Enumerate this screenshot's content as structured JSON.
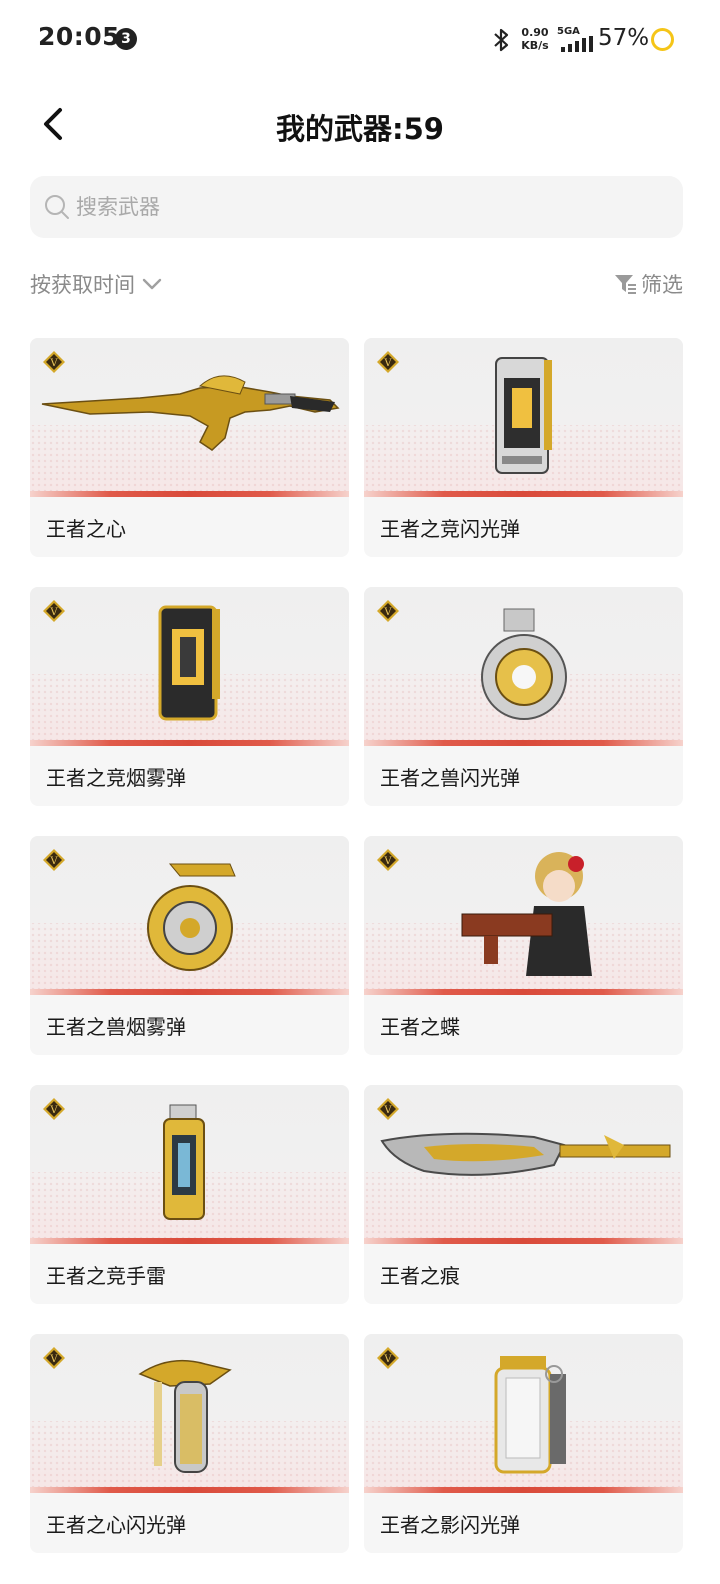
{
  "status_bar": {
    "time": "20:05",
    "notification_count": "3",
    "net_speed_value": "0.90",
    "net_speed_unit": "KB/s",
    "network_type": "5GA",
    "battery": "57%"
  },
  "header": {
    "title": "我的武器:59"
  },
  "search": {
    "placeholder": "搜索武器"
  },
  "toolbar": {
    "sort_label": "按获取时间",
    "filter_label": "筛选"
  },
  "colors": {
    "accent_red": "#d94a3a",
    "gold": "#d4a82a",
    "battery_ring": "#f5c518"
  },
  "weapons": [
    {
      "name": "王者之心",
      "icon": "rifle-icon"
    },
    {
      "name": "王者之竞闪光弹",
      "icon": "flashbang-icon"
    },
    {
      "name": "王者之竞烟雾弹",
      "icon": "smoke-grenade-icon"
    },
    {
      "name": "王者之兽闪光弹",
      "icon": "flashbang-icon"
    },
    {
      "name": "王者之兽烟雾弹",
      "icon": "smoke-grenade-icon"
    },
    {
      "name": "王者之蝶",
      "icon": "character-icon"
    },
    {
      "name": "王者之竞手雷",
      "icon": "grenade-icon"
    },
    {
      "name": "王者之痕",
      "icon": "blade-icon"
    },
    {
      "name": "王者之心闪光弹",
      "icon": "flashbang-icon"
    },
    {
      "name": "王者之影闪光弹",
      "icon": "flashbang-icon"
    }
  ]
}
